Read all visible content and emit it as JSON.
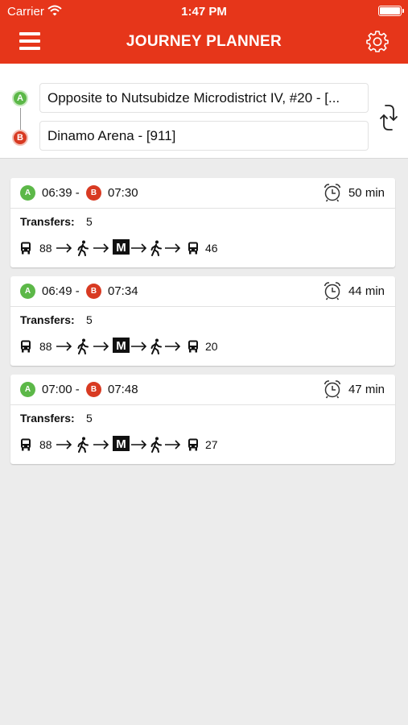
{
  "status_bar": {
    "carrier": "Carrier",
    "time": "1:47 PM",
    "battery_level": 1.0
  },
  "header": {
    "title": "JOURNEY PLANNER",
    "menu_icon": "hamburger-menu-icon",
    "settings_icon": "gear-icon",
    "background_color": "#e6361a"
  },
  "search": {
    "origin_marker": "A",
    "destination_marker": "B",
    "origin": "Opposite to Nutsubidze Microdistrict IV, #20 - [...",
    "destination": "Dinamo Arena - [911]",
    "swap_icon": "swap-direction-icon"
  },
  "journeys": [
    {
      "depart_marker": "A",
      "arrive_marker": "B",
      "depart": "06:39 -",
      "arrive": "07:30",
      "duration": "50 min",
      "transfers_label": "Transfers:",
      "transfers": "5",
      "first_bus": "88",
      "last_bus": "46",
      "metro_label": "M"
    },
    {
      "depart_marker": "A",
      "arrive_marker": "B",
      "depart": "06:49 -",
      "arrive": "07:34",
      "duration": "44 min",
      "transfers_label": "Transfers:",
      "transfers": "5",
      "first_bus": "88",
      "last_bus": "20",
      "metro_label": "M"
    },
    {
      "depart_marker": "A",
      "arrive_marker": "B",
      "depart": "07:00 -",
      "arrive": "07:48",
      "duration": "47 min",
      "transfers_label": "Transfers:",
      "transfers": "5",
      "first_bus": "88",
      "last_bus": "27",
      "metro_label": "M"
    }
  ],
  "colors": {
    "accent": "#e6361a",
    "origin_green": "#5cb848",
    "destination_red": "#d83a22",
    "background": "#ececec"
  }
}
